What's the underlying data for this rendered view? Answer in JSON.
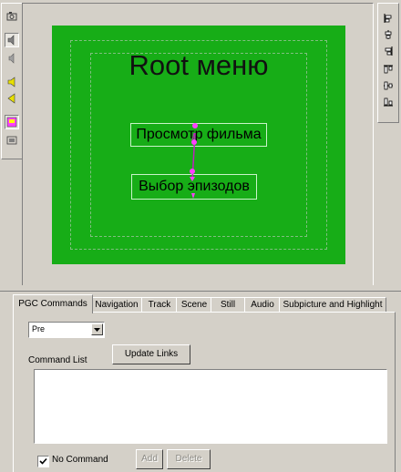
{
  "menu_preview": {
    "title": "Root меню",
    "buttons": [
      {
        "label": "Просмотр фильма"
      },
      {
        "label": "Выбор эпизодов"
      }
    ],
    "background_color": "#17ad17"
  },
  "left_toolbar": {
    "tools": [
      {
        "icon": "camera-icon"
      },
      {
        "icon": "speaker-icon",
        "active": true
      },
      {
        "icon": "speaker-small-icon"
      },
      {
        "icon": "yellow-speaker-icon"
      },
      {
        "icon": "yellow-arrow-left-icon"
      },
      {
        "icon": "highlight-button-icon",
        "active": true
      },
      {
        "icon": "layer-icon"
      }
    ]
  },
  "right_toolbar": {
    "tools": [
      {
        "icon": "align-left-icon"
      },
      {
        "icon": "align-center-icon"
      },
      {
        "icon": "align-right-icon"
      },
      {
        "icon": "align-top-icon"
      },
      {
        "icon": "align-middle-icon"
      },
      {
        "icon": "align-bottom-icon"
      }
    ]
  },
  "tabs": [
    {
      "label": "PGC Commands",
      "active": true
    },
    {
      "label": "Navigation"
    },
    {
      "label": "Track"
    },
    {
      "label": "Scene"
    },
    {
      "label": "Still"
    },
    {
      "label": "Audio"
    },
    {
      "label": "Subpicture and Highlight"
    }
  ],
  "pgc_commands": {
    "command_type_value": "Pre",
    "command_list_label": "Command List",
    "update_links_label": "Update Links",
    "no_command_label": "No Command",
    "no_command_checked": true,
    "add_label": "Add",
    "delete_label": "Delete"
  }
}
